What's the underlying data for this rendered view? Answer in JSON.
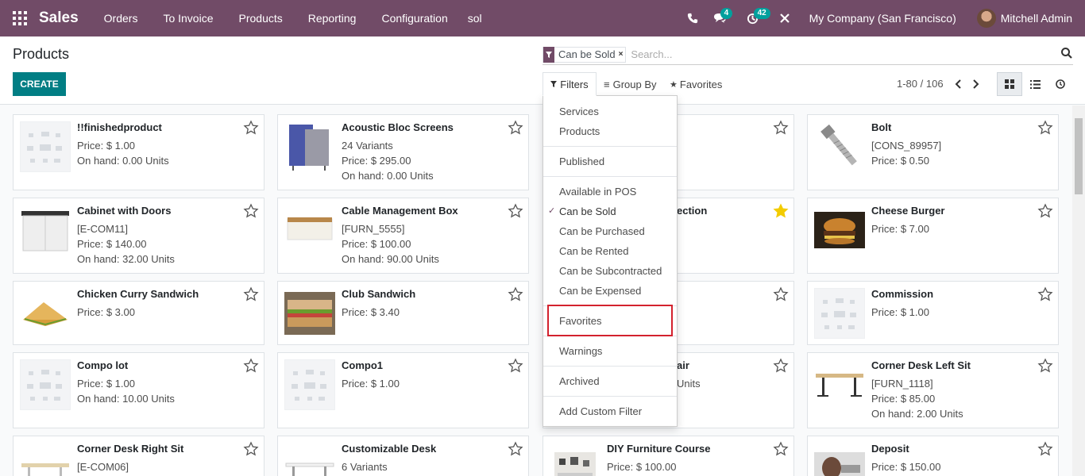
{
  "navbar": {
    "app_name": "Sales",
    "menu": [
      "Orders",
      "To Invoice",
      "Products",
      "Reporting",
      "Configuration",
      "sol"
    ],
    "messages_badge": "4",
    "activities_badge": "42",
    "company": "My Company (San Francisco)",
    "user": "Mitchell Admin",
    "accent_color": "#714b67"
  },
  "control_panel": {
    "title": "Products",
    "create_label": "CREATE",
    "facet": "Can be Sold",
    "search_placeholder": "Search...",
    "filters_label": "Filters",
    "groupby_label": "Group By",
    "favorites_label": "Favorites",
    "pager": "1-80 / 106"
  },
  "filters_menu": {
    "g1": [
      "Services",
      "Products"
    ],
    "g2": [
      "Published"
    ],
    "g3": [
      "Available in POS",
      "Can be Sold",
      "Can be Purchased",
      "Can be Rented",
      "Can be Subcontracted",
      "Can be Expensed"
    ],
    "g4": [
      "Favorites"
    ],
    "g5": [
      "Warnings"
    ],
    "g6": [
      "Archived"
    ],
    "g7": [
      "Add Custom Filter"
    ],
    "checked": "Can be Sold"
  },
  "cards": [
    {
      "title": "!!finishedproduct",
      "lines": [
        "Price: $ 1.00",
        "On hand: 0.00 Units"
      ],
      "image": "placeholder"
    },
    {
      "title": "Acoustic Bloc Screens",
      "lines": [
        "24 Variants",
        "Price: $ 295.00",
        "On hand: 0.00 Units"
      ],
      "image": "screens"
    },
    {
      "title": "",
      "lines": [],
      "image": "none"
    },
    {
      "title": "Bolt",
      "lines": [
        "[CONS_89957]",
        "Price: $ 0.50"
      ],
      "image": "bolt"
    },
    {
      "title": "Cabinet with Doors",
      "lines": [
        "[E-COM11]",
        "Price: $ 140.00",
        "On hand: 32.00 Units"
      ],
      "image": "cabinet"
    },
    {
      "title": "Cable Management Box",
      "lines": [
        "[FURN_5555]",
        "Price: $ 100.00",
        "On hand: 90.00 Units"
      ],
      "image": "cablebox"
    },
    {
      "title": "ection",
      "lines": [],
      "image": "none",
      "favorite": true
    },
    {
      "title": "Cheese Burger",
      "lines": [
        "Price: $ 7.00"
      ],
      "image": "burger"
    },
    {
      "title": "Chicken Curry Sandwich",
      "lines": [
        "Price: $ 3.00"
      ],
      "image": "sandwich"
    },
    {
      "title": "Club Sandwich",
      "lines": [
        "Price: $ 3.40"
      ],
      "image": "club"
    },
    {
      "title": "",
      "lines": [],
      "image": "none"
    },
    {
      "title": "Commission",
      "lines": [
        "Price: $ 1.00"
      ],
      "image": "placeholder"
    },
    {
      "title": "Compo lot",
      "lines": [
        "Price: $ 1.00",
        "On hand: 10.00 Units"
      ],
      "image": "placeholder"
    },
    {
      "title": "Compo1",
      "lines": [
        "Price: $ 1.00"
      ],
      "image": "placeholder"
    },
    {
      "title": "air",
      "lines": [
        "",
        "",
        "Units"
      ],
      "image": "none"
    },
    {
      "title": "Corner Desk Left Sit",
      "lines": [
        "[FURN_1118]",
        "Price: $ 85.00",
        "On hand: 2.00 Units"
      ],
      "image": "desk"
    },
    {
      "title": "Corner Desk Right Sit",
      "lines": [
        "[E-COM06]"
      ],
      "image": "desk2"
    },
    {
      "title": "Customizable Desk",
      "lines": [
        "6 Variants"
      ],
      "image": "desk3"
    },
    {
      "title": "DIY Furniture Course",
      "lines": [
        "Price: $ 100.00"
      ],
      "image": "room"
    },
    {
      "title": "Deposit",
      "lines": [
        "Price: $ 150.00"
      ],
      "image": "deposit"
    }
  ]
}
